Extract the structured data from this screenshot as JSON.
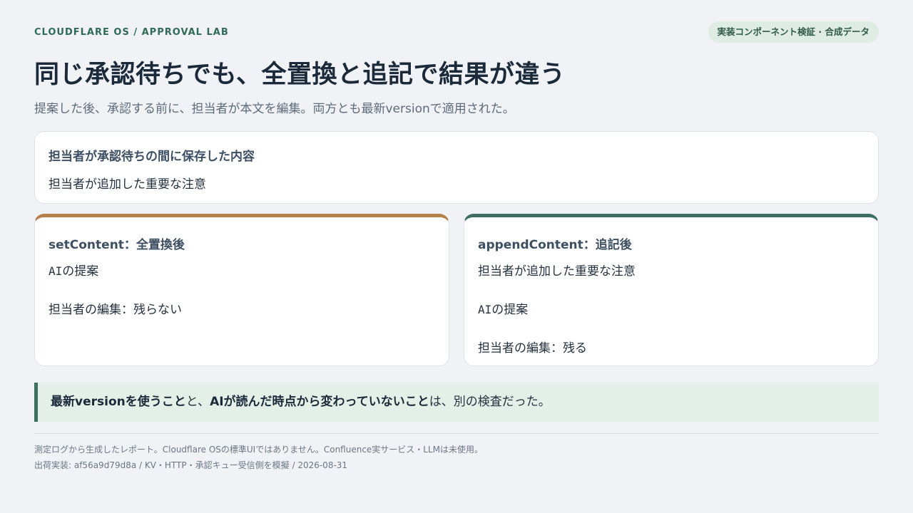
{
  "header": {
    "eyebrow": "CLOUDFLARE OS / APPROVAL LAB",
    "badge": "実装コンポーネント検証 · 合成データ"
  },
  "title": "同じ承認待ちでも、全置換と追記で結果が違う",
  "subtitle": "提案した後、承認する前に、担当者が本文を編集。両方とも最新versionで適用された。",
  "saved_card": {
    "heading": "担当者が承認待ちの間に保存した内容",
    "text": "担当者が追加した重要な注意"
  },
  "set_card": {
    "heading_code": "setContent",
    "heading_suffix": "：全置換後",
    "lines": [
      {
        "code": "AI",
        "rest": "の提案"
      },
      {
        "code": "",
        "rest": "担当者の編集：残らない"
      }
    ]
  },
  "append_card": {
    "heading_code": "appendContent",
    "heading_suffix": "：追記後",
    "lines": [
      {
        "code": "",
        "rest": "担当者が追加した重要な注意"
      },
      {
        "code": "AI",
        "rest": "の提案"
      },
      {
        "code": "",
        "rest": "担当者の編集：残る"
      }
    ]
  },
  "callout": {
    "strong1": "最新versionを使うこと",
    "mid": "と、",
    "strong2": "AIが読んだ時点から変わっていないこと",
    "end": "は、別の検査だった。"
  },
  "footer": {
    "line1": "測定ログから生成したレポート。Cloudflare OSの標準UIではありません。Confluence実サービス・LLMは未使用。",
    "line2": "出荷実装: af56a9d79d8a / KV・HTTP・承認キュー受信側を模擬 / 2026-08-31"
  },
  "colors": {
    "accent_green": "#3e6f5e",
    "accent_orange": "#b5804a",
    "callout_bg": "#e3efe7",
    "page_bg": "#f0f2f5"
  }
}
